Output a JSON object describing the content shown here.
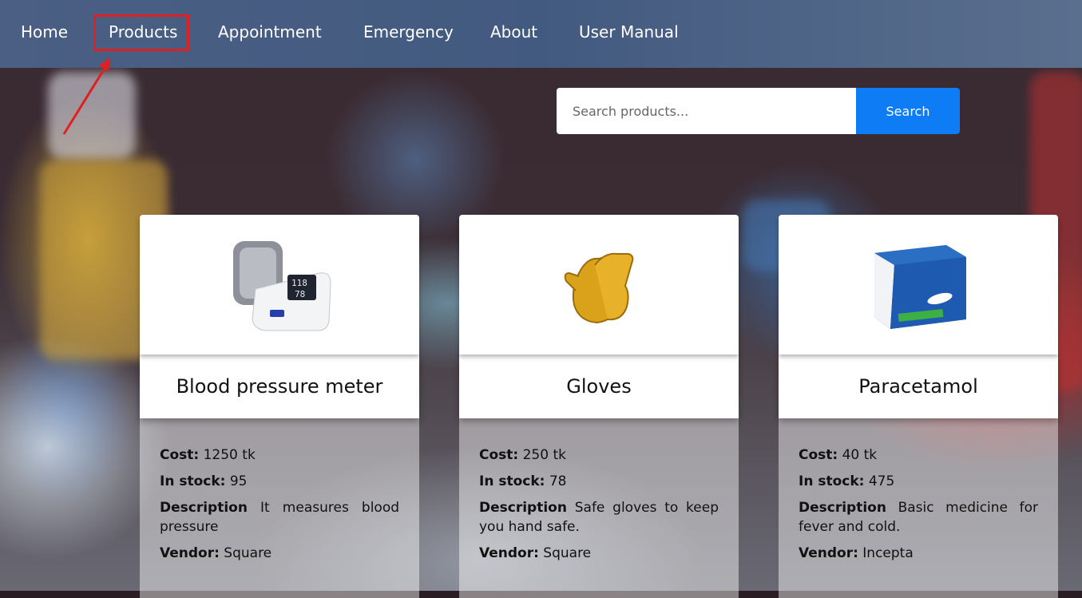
{
  "nav": {
    "items": [
      {
        "label": "Home"
      },
      {
        "label": "Products"
      },
      {
        "label": "Appointment"
      },
      {
        "label": "Emergency"
      },
      {
        "label": "About"
      },
      {
        "label": "User Manual"
      }
    ],
    "highlighted": "Products"
  },
  "search": {
    "placeholder": "Search products...",
    "value": "",
    "button_label": "Search"
  },
  "labels": {
    "cost": "Cost:",
    "stock": "In stock:",
    "description": "Description",
    "vendor": "Vendor:"
  },
  "products": [
    {
      "name": "Blood pressure meter",
      "cost": "1250 tk",
      "stock": "95",
      "description": "It measures blood pressure",
      "vendor": "Square",
      "image": "blood-pressure-monitor-icon"
    },
    {
      "name": "Gloves",
      "cost": "250 tk",
      "stock": "78",
      "description": "Safe gloves to keep you hand safe.",
      "vendor": "Square",
      "image": "gloves-icon"
    },
    {
      "name": "Paracetamol",
      "cost": "40 tk",
      "stock": "475",
      "description": "Basic medicine for fever and cold.",
      "vendor": "Incepta",
      "image": "paracetamol-box-icon"
    }
  ],
  "colors": {
    "nav_bg": "#4a5f83",
    "search_button": "#0d7cf5",
    "highlight_box": "#e02020"
  }
}
